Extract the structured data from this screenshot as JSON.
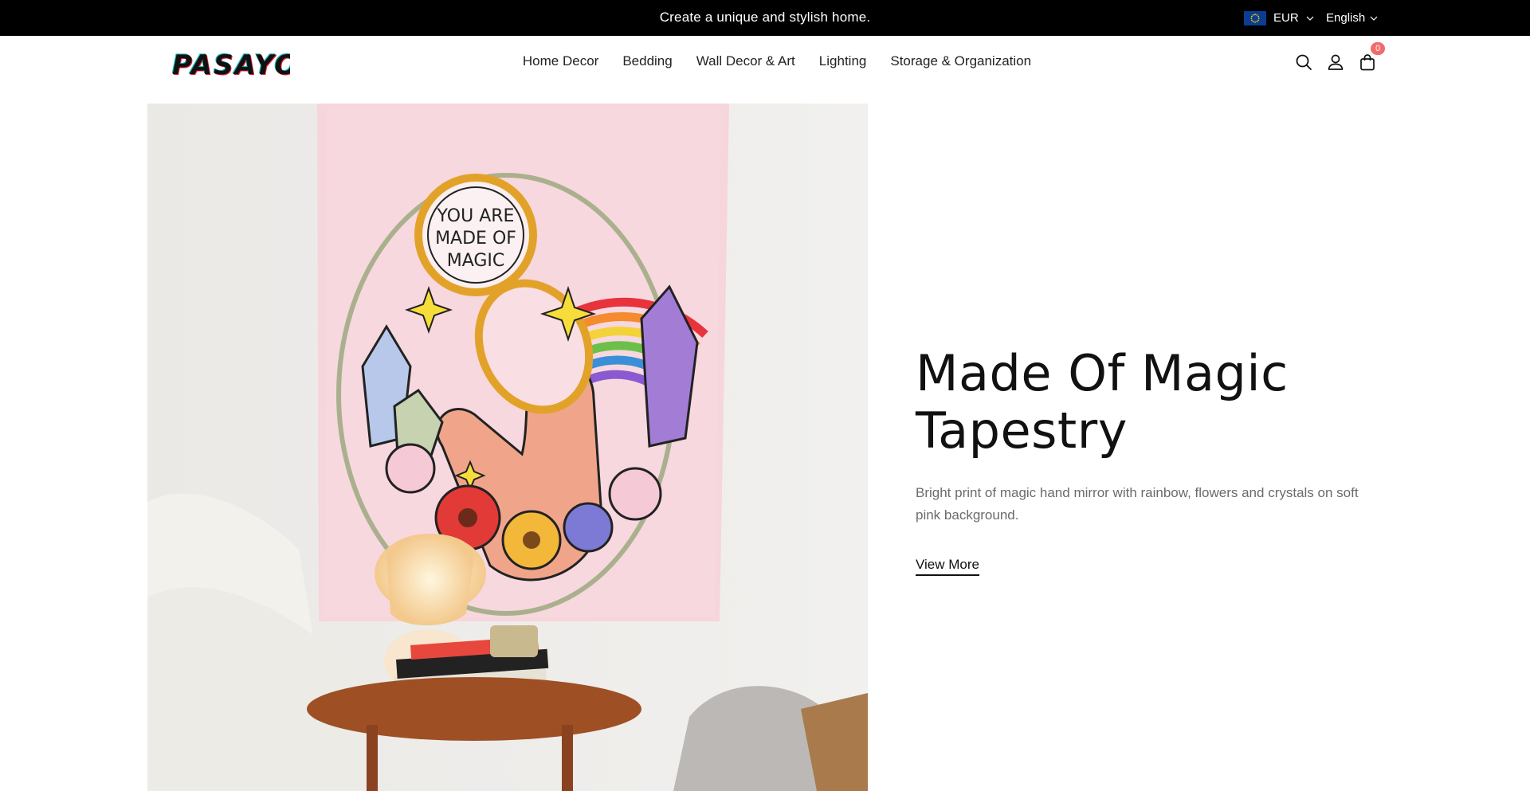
{
  "announcement": {
    "text": "Create a unique and stylish home."
  },
  "currency": {
    "value": "EUR",
    "flag_icon": "eu-flag-icon"
  },
  "language": {
    "value": "English"
  },
  "brand": {
    "logo_text": "PASAYO"
  },
  "nav": {
    "items": [
      {
        "label": "Home Decor"
      },
      {
        "label": "Bedding"
      },
      {
        "label": "Wall Decor & Art"
      },
      {
        "label": "Lighting"
      },
      {
        "label": "Storage & Organization"
      }
    ]
  },
  "header_icons": {
    "search": "search-icon",
    "account": "account-icon",
    "cart": "cart-icon",
    "cart_count": "0"
  },
  "hero": {
    "title_line1": "Made Of Magic",
    "title_line2": "Tapestry",
    "description": "Bright print of magic hand mirror with rainbow, flowers and crystals on soft pink background.",
    "cta_label": "View More",
    "tapestry_text": "YOU ARE MADE OF MAGIC"
  },
  "colors": {
    "announcement_bg": "#000000",
    "cart_badge": "#f26b6b",
    "tapestry_pink": "#f6d6dc",
    "accent_text": "#111111",
    "muted_text": "#6b6b6b"
  }
}
